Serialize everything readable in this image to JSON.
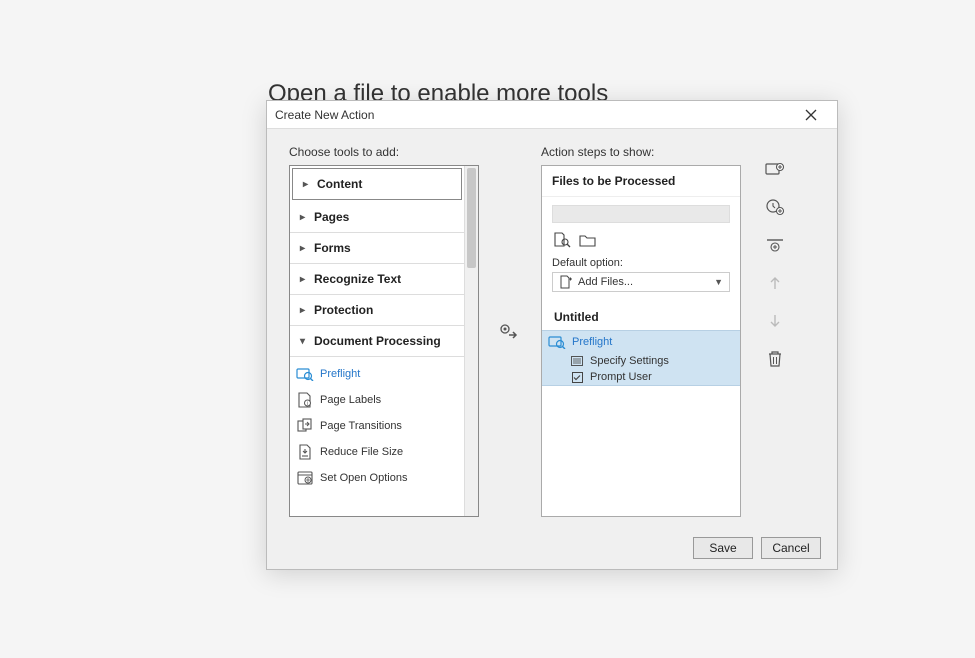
{
  "page": {
    "bgText": "Open a file to enable more tools"
  },
  "dialog": {
    "title": "Create New Action",
    "leftLabel": "Choose tools to add:",
    "rightLabel": "Action steps to show:",
    "categories": {
      "content": "Content",
      "pages": "Pages",
      "forms": "Forms",
      "recognize": "Recognize Text",
      "protection": "Protection",
      "docproc": "Document Processing"
    },
    "docprocItems": {
      "preflight": "Preflight",
      "pageLabels": "Page Labels",
      "pageTransitions": "Page Transitions",
      "reduceFileSize": "Reduce File Size",
      "setOpenOptions": "Set Open Options"
    },
    "rightPanel": {
      "filesHeader": "Files to be Processed",
      "defaultOption": "Default option:",
      "addFiles": "Add Files...",
      "untitled": "Untitled",
      "stepName": "Preflight",
      "specify": "Specify Settings",
      "prompt": "Prompt User"
    },
    "buttons": {
      "save": "Save",
      "cancel": "Cancel"
    }
  }
}
